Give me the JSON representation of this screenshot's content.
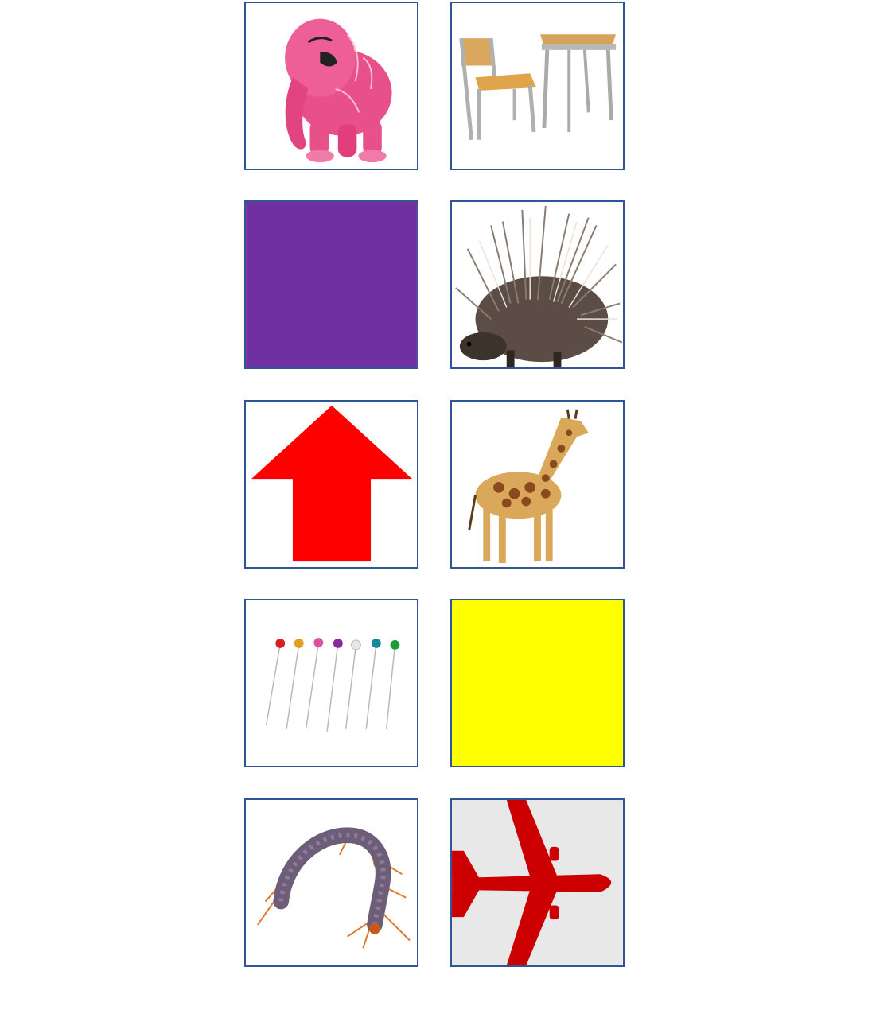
{
  "cards": [
    {
      "icon": "pink-elephant-icon"
    },
    {
      "icon": "school-desk-chair-icon"
    },
    {
      "icon": "purple-square-icon",
      "color": "#7030a0"
    },
    {
      "icon": "porcupine-icon"
    },
    {
      "icon": "red-up-arrow-icon",
      "color": "#ff0000"
    },
    {
      "icon": "giraffe-icon"
    },
    {
      "icon": "pins-icon"
    },
    {
      "icon": "yellow-square-icon",
      "color": "#ffff00"
    },
    {
      "icon": "centipede-icon"
    },
    {
      "icon": "red-airplane-icon",
      "color": "#cc0000"
    }
  ],
  "colors": {
    "border": "#2f5597",
    "background": "#ffffff"
  }
}
